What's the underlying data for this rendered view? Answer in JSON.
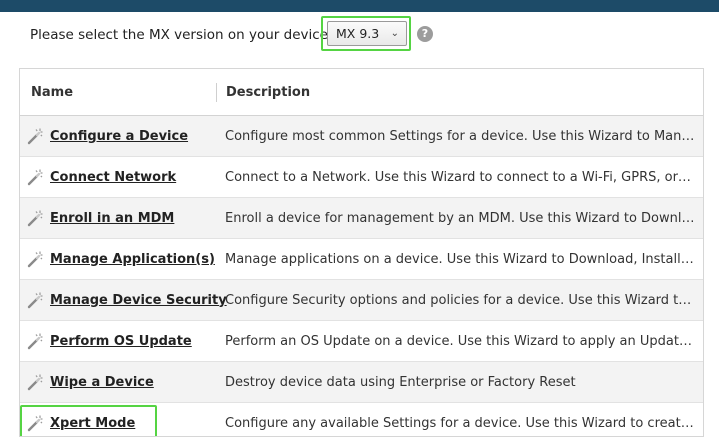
{
  "header": {
    "select_label": "Please select the MX version on your device:",
    "mx_version": {
      "value": "MX 9.3",
      "caret": "⌄"
    },
    "help_glyph": "?"
  },
  "grid": {
    "columns": {
      "name": "Name",
      "description": "Description"
    },
    "rows": [
      {
        "name": "Configure a Device",
        "description": "Configure most common Settings for a device. Use this Wizard to Manage..."
      },
      {
        "name": "Connect Network",
        "description": "Connect to a Network. Use this Wizard to connect to a Wi-Fi, GPRS, or Ethe..."
      },
      {
        "name": "Enroll in an MDM",
        "description": "Enroll a device for management by an MDM.  Use this Wizard to Download,..."
      },
      {
        "name": "Manage Application(s)",
        "description": "Manage applications on a device.  Use this Wizard to Download, Install, Uni..."
      },
      {
        "name": "Manage Device Security",
        "description": "Configure Security options and policies for a device.  Use this Wizard to Wh..."
      },
      {
        "name": "Perform OS Update",
        "description": "Perform an OS Update on a device.  Use this Wizard to apply an Update or..."
      },
      {
        "name": "Wipe a Device",
        "description": "Destroy device data using Enterprise or Factory Reset"
      },
      {
        "name": "Xpert Mode",
        "description": "Configure any available Settings for a device. Use this Wizard to create any..."
      }
    ]
  },
  "colors": {
    "topbar": "#1d4b68",
    "highlight": "#55d443"
  },
  "icons": {
    "row_icon": "magic-wand-icon",
    "help": "help-icon",
    "dropdown": "chevron-down-icon"
  }
}
